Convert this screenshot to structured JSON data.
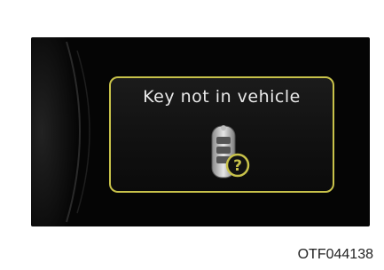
{
  "display": {
    "message": "Key not in vehicle",
    "accent_color": "#c8c24a",
    "icon": "smart-key-question-icon",
    "badge_glyph": "?"
  },
  "caption": "OTF044138"
}
